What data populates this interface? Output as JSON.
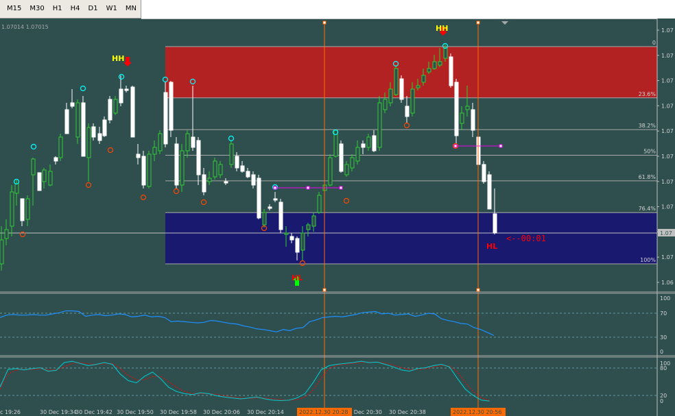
{
  "toolbar": {
    "timeframes": [
      "M15",
      "M30",
      "H1",
      "H4",
      "D1",
      "W1",
      "MN"
    ]
  },
  "main_chart": {
    "ohlc_label": "1.07014 1.07015",
    "price_ticks": [
      "1.07",
      "1.07",
      "1.07",
      "1.07",
      "1.07",
      "1.07",
      "1.07",
      "1.07",
      "1.07",
      "1.07",
      "1.06"
    ],
    "current_price_label": "1.07",
    "fib_levels": [
      {
        "label": "0",
        "level": 0
      },
      {
        "label": "23.6%",
        "level": 0.236
      },
      {
        "label": "38.2%",
        "level": 0.382
      },
      {
        "label": "50%",
        "level": 0.5
      },
      {
        "label": "61.8%",
        "level": 0.618
      },
      {
        "label": "76.4%",
        "level": 0.764
      },
      {
        "label": "100%",
        "level": 1.0
      }
    ],
    "markers": [
      {
        "label": "HH",
        "color": "#ffff00",
        "arrow": "down"
      },
      {
        "label": "HH",
        "color": "#ffff00",
        "arrow": "down"
      },
      {
        "label": "HL",
        "color": "#ff0000",
        "arrow": "up"
      },
      {
        "label": "HL",
        "color": "#ff0000",
        "arrow": "none"
      }
    ],
    "timer_text": "<--00:01",
    "zone_colors": {
      "supply": "#b22222",
      "demand": "#191970"
    },
    "bull_color": "#32cd32",
    "bear_color": "#ffffff"
  },
  "rsi_panel": {
    "ticks": [
      "100",
      "70",
      "30",
      "0"
    ],
    "series_color": "#1e90ff",
    "values": [
      62,
      66,
      67,
      66,
      66,
      67,
      66,
      66,
      68,
      70,
      73,
      73,
      72,
      64,
      66,
      67,
      65,
      66,
      68,
      67,
      63,
      64,
      66,
      63,
      64,
      62,
      55,
      56,
      55,
      54,
      53,
      54,
      57,
      56,
      54,
      52,
      51,
      48,
      46,
      43,
      42,
      40,
      38,
      42,
      40,
      44,
      45,
      55,
      58,
      62,
      63,
      64,
      63,
      65,
      67,
      70,
      71,
      72,
      68,
      69,
      66,
      67,
      68,
      64,
      66,
      69,
      68,
      60,
      57,
      55,
      52,
      51,
      45,
      42,
      37,
      32
    ]
  },
  "stoch_panel": {
    "ticks": [
      "100",
      "80",
      "20",
      "0"
    ],
    "main_color": "#00ced1",
    "signal_color": "#ff0000",
    "main_values": [
      35,
      76,
      78,
      75,
      78,
      80,
      72,
      74,
      92,
      95,
      90,
      85,
      88,
      92,
      88,
      65,
      50,
      45,
      60,
      70,
      55,
      35,
      25,
      20,
      18,
      22,
      20,
      15,
      12,
      10,
      8,
      10,
      12,
      8,
      5,
      4,
      5,
      10,
      20,
      45,
      75,
      85,
      88,
      90,
      92,
      95,
      92,
      93,
      88,
      82,
      75,
      72,
      78,
      80,
      85,
      88,
      82,
      55,
      30,
      15,
      5,
      3
    ],
    "signal_values": [
      30,
      65,
      75,
      76,
      76,
      78,
      75,
      75,
      82,
      90,
      92,
      89,
      88,
      89,
      90,
      78,
      62,
      52,
      52,
      60,
      60,
      48,
      35,
      25,
      20,
      20,
      20,
      18,
      15,
      12,
      10,
      9,
      10,
      10,
      8,
      6,
      5,
      6,
      12,
      28,
      55,
      78,
      86,
      88,
      90,
      92,
      93,
      93,
      91,
      86,
      80,
      76,
      76,
      78,
      82,
      85,
      84,
      70,
      45,
      25,
      10,
      4
    ]
  },
  "time_axis": {
    "labels": [
      "c 19:26",
      "30 Dec 19:34",
      "30 Dec 19:42",
      "30 Dec 19:50",
      "30 Dec 19:58",
      "30 Dec 20:06",
      "30 Dec 20:14",
      "30 Dec 20:30",
      "30 Dec 20:38",
      "2022.12.30 20:28",
      "2022.12.30 20:56"
    ],
    "highlight_color": "#ff6a00"
  }
}
